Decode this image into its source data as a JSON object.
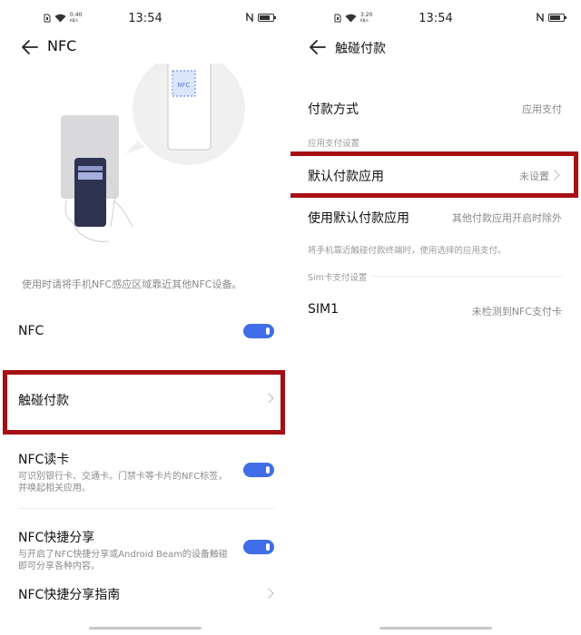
{
  "left": {
    "status": {
      "time": "13:54",
      "speed_value": "0.40",
      "speed_unit": "KB/s"
    },
    "header": {
      "title": "NFC"
    },
    "illustration": {
      "tag_label": "NFC"
    },
    "hint": "使用时请将手机NFC感应区域靠近其他NFC设备。",
    "settings": {
      "nfc": {
        "label": "NFC",
        "enabled": true
      },
      "touch_pay": {
        "label": "触碰付款"
      },
      "nfc_read": {
        "label": "NFC读卡",
        "desc": "可识别银行卡、交通卡。门禁卡等卡片的NFC标签，并唤起相关应用。",
        "enabled": true
      },
      "nfc_share": {
        "label": "NFC快捷分享",
        "desc": "与开启了NFC快捷分享或Android Beam的设备触碰即可分享各种内容。",
        "enabled": true
      },
      "nfc_guide": {
        "label": "NFC快捷分享指南"
      }
    }
  },
  "right": {
    "status": {
      "time": "13:54",
      "speed_value": "3.20",
      "speed_unit": "KB/s"
    },
    "header": {
      "title": "触碰付款"
    },
    "items": {
      "pay_method": {
        "label": "付款方式",
        "value": "应用支付"
      },
      "section_app": "应用支付设置",
      "default_app": {
        "label": "默认付款应用",
        "value": "未设置"
      },
      "use_default": {
        "label": "使用默认付款应用",
        "value": "其他付款应用开启时除外"
      },
      "use_default_hint": "将手机靠近触碰付款终端时，使用选择的应用支付。",
      "section_sim": "Sim卡支付设置",
      "sim1": {
        "label": "SIM1",
        "value": "未检测到NFC支付卡"
      }
    }
  },
  "colors": {
    "accent": "#3f6ee8",
    "highlight": "#a50f14"
  }
}
